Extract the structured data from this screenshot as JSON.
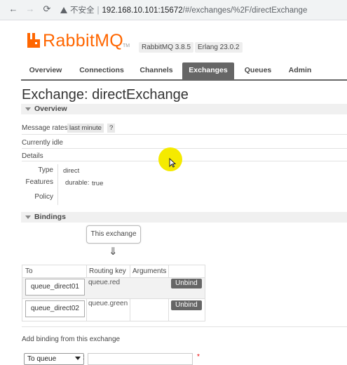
{
  "browser": {
    "security_warning": "不安全",
    "address_host": "192.168.10.101:15672",
    "address_path": "/#/exchanges/%2F/directExchange"
  },
  "header": {
    "logo": "RabbitMQ",
    "trademark": "TM",
    "version_badge": "RabbitMQ 3.8.5",
    "erlang_badge": "Erlang 23.0.2"
  },
  "tabs": [
    {
      "label": "Overview"
    },
    {
      "label": "Connections"
    },
    {
      "label": "Channels"
    },
    {
      "label": "Exchanges",
      "active": true
    },
    {
      "label": "Queues"
    },
    {
      "label": "Admin"
    }
  ],
  "page": {
    "title": "Exchange: directExchange"
  },
  "overview": {
    "section_label": "Overview",
    "message_rates_label": "Message rates",
    "message_rates_value": "last minute",
    "help": "?",
    "status": "Currently idle",
    "details_label": "Details",
    "details": {
      "type_key": "Type",
      "type_value": "direct",
      "features_key": "Features",
      "features_durable_key": "durable:",
      "features_durable_value": "true",
      "policy_key": "Policy",
      "policy_value": ""
    }
  },
  "bindings": {
    "section_label": "Bindings",
    "this_exchange": "This exchange",
    "arrow": "⇓",
    "columns": {
      "to": "To",
      "routing_key": "Routing key",
      "arguments": "Arguments"
    },
    "rows": [
      {
        "to": "queue_direct01",
        "routing_key": "queue.red",
        "unbind": "Unbind"
      },
      {
        "to": "queue_direct02",
        "routing_key": "queue.green",
        "unbind": "Unbind"
      }
    ]
  },
  "add_binding": {
    "label": "Add binding from this exchange",
    "destination_type": "To queue",
    "colon": ":",
    "required_mark": "*"
  },
  "colors": {
    "brand": "#ff6600",
    "tab_active": "#666666",
    "cursor_highlight": "#f5ea00"
  }
}
